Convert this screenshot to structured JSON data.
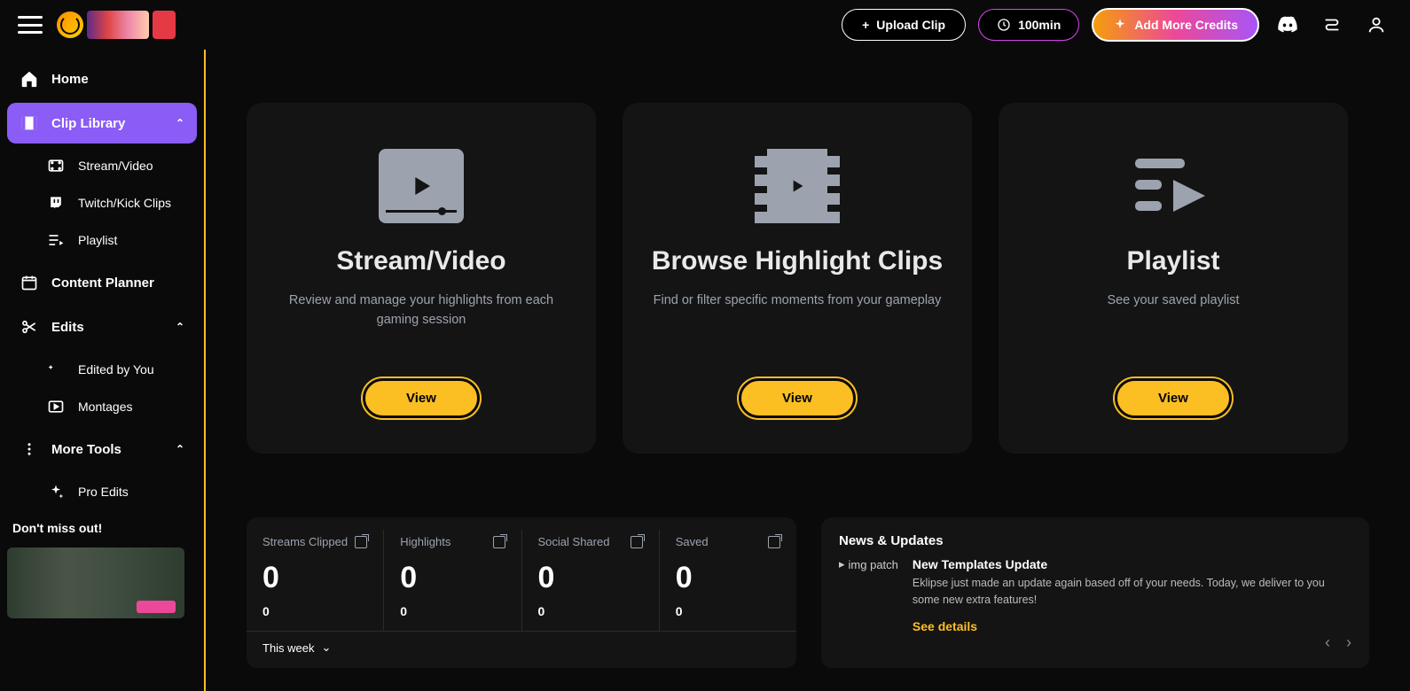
{
  "header": {
    "upload_label": "Upload Clip",
    "minutes_label": "100min",
    "credits_label": "Add More Credits"
  },
  "sidebar": {
    "home": "Home",
    "clip_library": "Clip Library",
    "stream_video": "Stream/Video",
    "twitch_kick": "Twitch/Kick Clips",
    "playlist": "Playlist",
    "content_planner": "Content Planner",
    "edits": "Edits",
    "edited_by_you": "Edited by You",
    "montages": "Montages",
    "more_tools": "More Tools",
    "pro_edits": "Pro Edits",
    "dont_miss": "Don't miss out!"
  },
  "cards": [
    {
      "title": "Stream/Video",
      "desc": "Review and manage your highlights from each gaming session",
      "button": "View"
    },
    {
      "title": "Browse Highlight Clips",
      "desc": "Find or filter specific moments from your gameplay",
      "button": "View"
    },
    {
      "title": "Playlist",
      "desc": "See your saved playlist",
      "button": "View"
    }
  ],
  "stats": {
    "labels": [
      "Streams Clipped",
      "Highlights",
      "Social Shared",
      "Saved"
    ],
    "big": [
      "0",
      "0",
      "0",
      "0"
    ],
    "small": [
      "0",
      "0",
      "0",
      "0"
    ],
    "period": "This week"
  },
  "news": {
    "section": "News & Updates",
    "thumb_alt": "img patch",
    "headline": "New Templates Update",
    "description": "Eklipse just made an update again based off of your needs. Today, we deliver to you some new extra features!",
    "link": "See details"
  }
}
